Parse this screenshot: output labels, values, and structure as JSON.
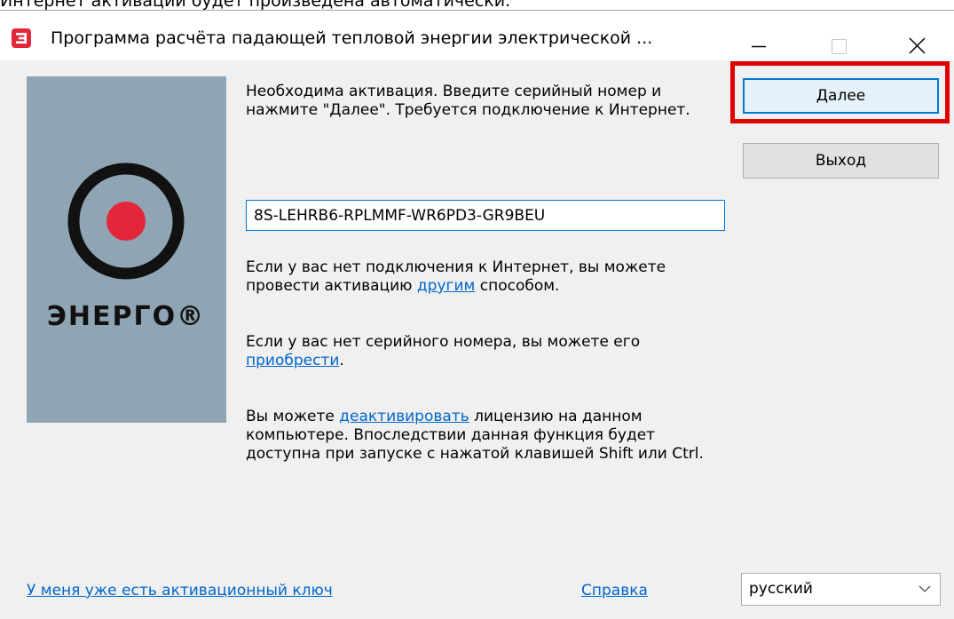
{
  "context_text": "Интернет активации будет произведена автоматически.",
  "window": {
    "title": "Программа расчёта падающей тепловой энергии электрической ...",
    "minimize_icon": "minimize-icon",
    "maximize_icon": "maximize-icon",
    "close_icon": "close-icon"
  },
  "logo": {
    "brand": "ЭНЕРГО®"
  },
  "intro_text": "Необходима активация. Введите серийный номер и нажмите \"Далее\". Требуется подключение к Интернет.",
  "serial": {
    "value": "8S-LEHRB6-RPLMMF-WR6PD3-GR9BEU"
  },
  "no_internet": {
    "before": "Если у вас нет подключения к Интернет, вы можете провести активацию ",
    "link": "другим",
    "after": " способом."
  },
  "no_serial": {
    "before": "Если у вас нет серийного номера, вы можете его ",
    "link": "приобрести",
    "after": "."
  },
  "deactivate": {
    "before": "Вы можете ",
    "link": "деактивировать",
    "after": " лицензию на данном компьютере. Впоследствии данная функция будет доступна при запуске с нажатой клавишей Shift или Ctrl."
  },
  "buttons": {
    "next": "Далее",
    "exit": "Выход"
  },
  "footer": {
    "have_key": "У меня уже есть активационный ключ",
    "help": "Справка",
    "language": "русский"
  },
  "colors": {
    "accent": "#0078d7",
    "highlight": "#e00000",
    "logo_bg": "#8fa5b3",
    "logo_dot": "#e3263a"
  }
}
